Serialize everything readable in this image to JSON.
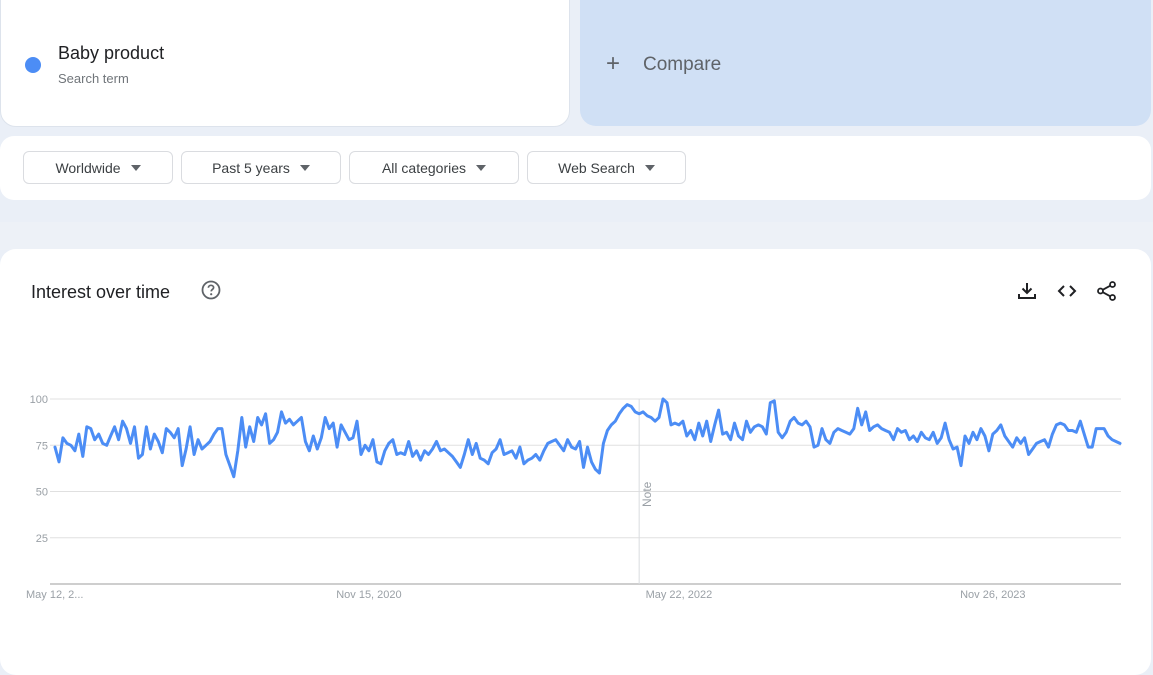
{
  "search_term": {
    "name": "Baby product",
    "subtitle": "Search term",
    "color": "#4c8df5"
  },
  "compare": {
    "icon": "plus-icon",
    "label": "Compare"
  },
  "filters": [
    {
      "label": "Worldwide",
      "icon": "caret-down-icon"
    },
    {
      "label": "Past 5 years",
      "icon": "caret-down-icon"
    },
    {
      "label": "All categories",
      "icon": "caret-down-icon"
    },
    {
      "label": "Web Search",
      "icon": "caret-down-icon"
    }
  ],
  "chart_card": {
    "title": "Interest over time",
    "help_icon": "help-circle-icon",
    "actions": [
      "download-icon",
      "embed-code-icon",
      "share-icon"
    ]
  },
  "chart_data": {
    "type": "line",
    "title": "Interest over time",
    "xlabel": "",
    "ylabel": "",
    "ylim": [
      0,
      100
    ],
    "yticks": [
      25,
      50,
      75,
      100
    ],
    "grid": true,
    "legend": "none",
    "x_tick_labels": [
      "May 12, 2...",
      "Nov 15, 2020",
      "May 22, 2022",
      "Nov 26, 2023"
    ],
    "x_tick_positions": [
      0,
      79,
      157,
      236
    ],
    "annotation": {
      "label": "Note",
      "index": 147
    },
    "series": [
      {
        "name": "Baby product",
        "color": "#4c8df5",
        "values": [
          74,
          66,
          79,
          76,
          75,
          72,
          81,
          69,
          85,
          84,
          78,
          81,
          76,
          75,
          80,
          85,
          78,
          88,
          84,
          76,
          85,
          68,
          70,
          85,
          73,
          81,
          77,
          71,
          84,
          82,
          79,
          84,
          64,
          73,
          85,
          70,
          78,
          73,
          75,
          77,
          81,
          84,
          84,
          70,
          64,
          58,
          72,
          90,
          74,
          85,
          77,
          90,
          86,
          92,
          76,
          78,
          82,
          93,
          87,
          89,
          86,
          88,
          90,
          77,
          72,
          80,
          73,
          79,
          90,
          84,
          87,
          74,
          86,
          82,
          78,
          79,
          88,
          70,
          75,
          72,
          78,
          66,
          65,
          72,
          76,
          78,
          70,
          71,
          70,
          77,
          69,
          72,
          67,
          72,
          70,
          73,
          77,
          72,
          73,
          71,
          69,
          66,
          63,
          70,
          78,
          70,
          76,
          68,
          67,
          65,
          71,
          73,
          78,
          70,
          71,
          72,
          68,
          74,
          65,
          67,
          68,
          70,
          67,
          72,
          76,
          77,
          78,
          75,
          72,
          78,
          74,
          73,
          77,
          63,
          74,
          66,
          62,
          60,
          76,
          83,
          86,
          88,
          92,
          95,
          97,
          96,
          93,
          92,
          93,
          91,
          90,
          88,
          90,
          100,
          98,
          86,
          87,
          86,
          88,
          80,
          83,
          78,
          87,
          80,
          88,
          77,
          86,
          94,
          81,
          82,
          78,
          87,
          80,
          78,
          88,
          82,
          85,
          86,
          85,
          81,
          98,
          99,
          82,
          79,
          82,
          88,
          90,
          87,
          86,
          88,
          85,
          74,
          75,
          84,
          78,
          76,
          82,
          84,
          83,
          82,
          81,
          84,
          95,
          86,
          93,
          83,
          85,
          86,
          84,
          83,
          82,
          78,
          84,
          82,
          83,
          78,
          80,
          77,
          82,
          79,
          78,
          82,
          76,
          79,
          87,
          78,
          73,
          74,
          64,
          80,
          76,
          82,
          78,
          84,
          80,
          72,
          81,
          83,
          86,
          80,
          77,
          74,
          79,
          76,
          79,
          70,
          73,
          76,
          77,
          78,
          74,
          81,
          86,
          87,
          86,
          83,
          83,
          82,
          88,
          81,
          74,
          74,
          84,
          84,
          84,
          80,
          78,
          77,
          76
        ]
      }
    ]
  }
}
